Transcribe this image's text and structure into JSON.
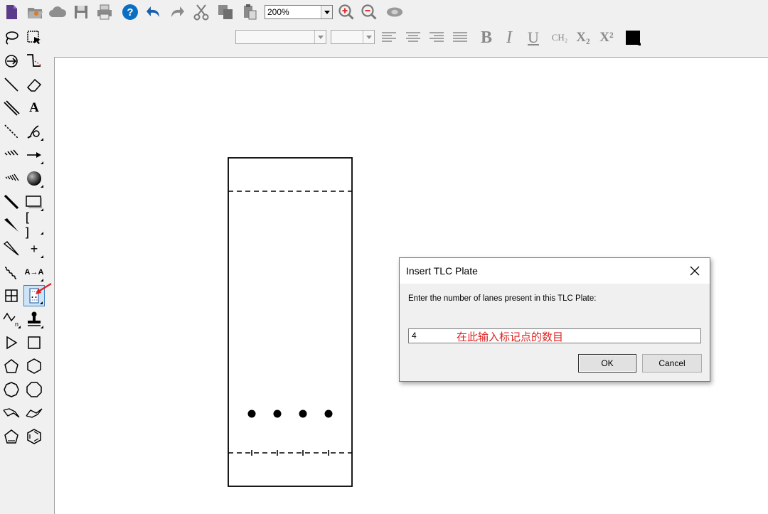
{
  "toolbar": {
    "zoom_value": "200%",
    "icons": [
      "new-document-icon",
      "open-icon",
      "cloud-icon",
      "save-icon",
      "print-icon",
      "help-icon",
      "undo-icon",
      "redo-icon",
      "cut-icon",
      "copy-icon",
      "paste-icon",
      "zoom-in-icon",
      "zoom-out-icon",
      "show-all-icon"
    ]
  },
  "format_bar": {
    "bold_label": "B",
    "italic_label": "I",
    "underline_label": "U",
    "formula_label": "CH₂",
    "subscript_label": "X₂",
    "superscript_label": "X²"
  },
  "palette": {
    "text_tool_label": "A",
    "plus_label": "+",
    "brackets_label": "[ ]",
    "mapping_label": "A→A"
  },
  "tlc_plate": {
    "lanes": 4
  },
  "dialog": {
    "title": "Insert TLC Plate",
    "prompt": "Enter the number of lanes present in this TLC Plate:",
    "input_value": "4",
    "annotation": "在此输入标记点的数目",
    "ok_label": "OK",
    "cancel_label": "Cancel"
  },
  "colors": {
    "annotation_red": "#e02020",
    "help_blue": "#0a6fc2",
    "document_purple": "#5b3a8c"
  }
}
